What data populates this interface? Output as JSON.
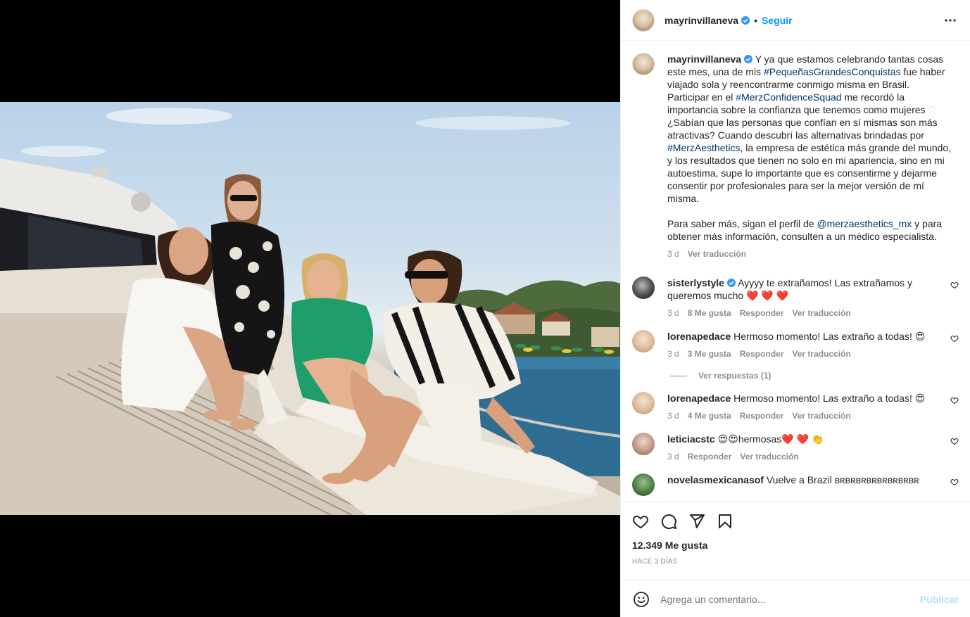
{
  "post": {
    "author": "mayrinvillaneva",
    "follow_label": "Seguir",
    "separator": "•",
    "caption": {
      "p1_a": "Y ya que estamos celebrando tantas cosas este mes, una de mis ",
      "tag1": "#PequeñasGrandesConquistas",
      "p1_b": " fue haber viajado sola y reencontrarme conmigo misma en Brasil. Participar en el ",
      "tag2": "#MerzConfidenceSquad",
      "p1_c": " me recordó la importancia sobre la confianza que tenemos como mujeres ",
      "heart_glyph": "♡",
      "p1_d": " ¿Sabían que las personas que confían en sí mismas son más atractivas? Cuando descubrí las alternativas brindadas por ",
      "tag3": "#MerzAesthetics",
      "p1_e": ", la empresa de estética más grande del mundo, y los resultados que tienen no solo en mi apariencia, sino en mi autoestima, supe lo importante que es consentirme y dejarme consentir por profesionales para ser la mejor versión de mí misma.",
      "p2_a": "Para saber más, sigan el perfil de ",
      "mention": "@merzaesthetics_mx",
      "p2_b": " y para obtener más información, consulten a un médico especialista.",
      "time": "3 d",
      "translate": "Ver traducción"
    },
    "likes": "12.349 Me gusta",
    "posted_ago": "Hace 3 días"
  },
  "comments": [
    {
      "user": "sisterlystyle",
      "verified": true,
      "text": "Ayyyy te extrañamos! Las extrañamos y queremos mucho ",
      "emoji": "❤️ ❤️ ❤️",
      "time": "3 d",
      "likes": "8 Me gusta",
      "reply": "Responder",
      "translate": "Ver traducción"
    },
    {
      "user": "lorenapedace",
      "text": "Hermoso momento! Las extraño a todas! ",
      "emoji": "😍",
      "time": "3 d",
      "likes": "3 Me gusta",
      "reply": "Responder",
      "translate": "Ver traducción",
      "view_replies": "Ver respuestas (1)"
    },
    {
      "user": "lorenapedace",
      "text": "Hermoso momento! Las extraño a todas! ",
      "emoji": "😍",
      "time": "3 d",
      "likes": "4 Me gusta",
      "reply": "Responder",
      "translate": "Ver traducción"
    },
    {
      "user": "leticiacstc",
      "text_a": "😍😍",
      "text": "hermosas",
      "emoji": "❤️ ❤️ 👏",
      "time": "3 d",
      "reply": "Responder",
      "translate": "Ver traducción"
    },
    {
      "user": "novelasmexicanasof",
      "text": "Vuelve a Brazil ʙʀʙʀʙʀʙʀʙʀʙʀʙʀʙʀ"
    }
  ],
  "composer": {
    "placeholder": "Agrega un comentario...",
    "post_label": "Publicar"
  },
  "icons": [
    "more-options-icon",
    "verified-badge-icon",
    "like-icon",
    "comment-icon",
    "share-icon",
    "save-icon",
    "emoji-icon",
    "small-heart-icon"
  ],
  "colors": {
    "link": "#00376b",
    "follow": "#0095f6",
    "muted": "#8e8e8e",
    "publish_disabled": "#b2dffc"
  }
}
